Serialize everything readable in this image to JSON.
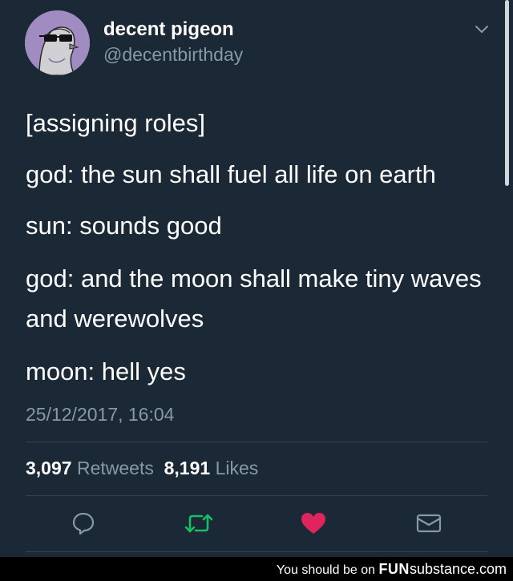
{
  "tweet": {
    "author": {
      "display_name": "decent pigeon",
      "handle": "@decentbirthday",
      "avatar_icon": "pigeon-with-sunglasses-icon"
    },
    "lines": [
      "[assigning roles]",
      "god: the sun shall fuel all life on earth",
      "sun: sounds good",
      "god: and the moon shall make tiny waves and werewolves",
      "moon: hell yes"
    ],
    "timestamp": "25/12/2017, 16:04",
    "stats": {
      "retweets_count": "3,097",
      "retweets_label": "Retweets",
      "likes_count": "8,191",
      "likes_label": "Likes"
    },
    "actions": {
      "reply_icon": "reply-bubble-icon",
      "retweet_icon": "retweet-icon",
      "like_icon": "heart-icon",
      "dm_icon": "envelope-icon"
    }
  },
  "colors": {
    "background": "#1b2836",
    "secondary_text": "#8899a6",
    "retweet_green": "#17bf63",
    "like_red": "#e0245e",
    "divider": "#38444d"
  },
  "footer": {
    "prefix": "You should be on",
    "brand_bold": "FUN",
    "brand_rest": "substance.com"
  }
}
